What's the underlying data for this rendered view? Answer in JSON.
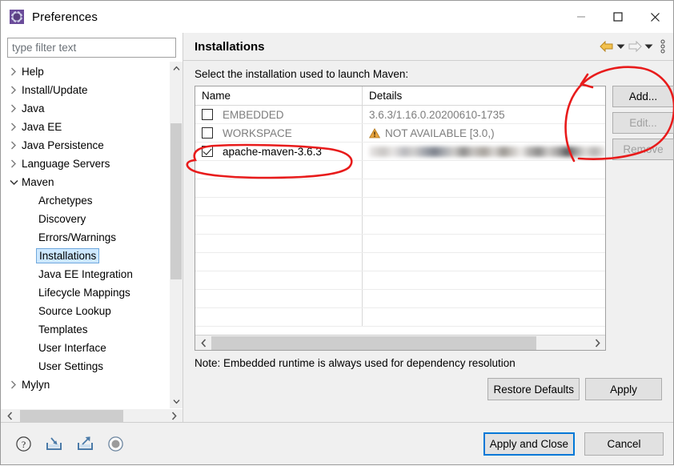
{
  "window": {
    "title": "Preferences",
    "app_icon": "gear-icon",
    "controls": {
      "minimize": "minimize-icon",
      "maximize": "maximize-icon",
      "close": "close-icon"
    }
  },
  "sidebar": {
    "filter": {
      "placeholder": "type filter text",
      "value": ""
    },
    "items": [
      {
        "label": "Help",
        "level": 0,
        "twisty": "collapsed",
        "selected": false
      },
      {
        "label": "Install/Update",
        "level": 0,
        "twisty": "collapsed",
        "selected": false
      },
      {
        "label": "Java",
        "level": 0,
        "twisty": "collapsed",
        "selected": false
      },
      {
        "label": "Java EE",
        "level": 0,
        "twisty": "collapsed",
        "selected": false
      },
      {
        "label": "Java Persistence",
        "level": 0,
        "twisty": "collapsed",
        "selected": false
      },
      {
        "label": "Language Servers",
        "level": 0,
        "twisty": "collapsed",
        "selected": false
      },
      {
        "label": "Maven",
        "level": 0,
        "twisty": "expanded",
        "selected": false
      },
      {
        "label": "Archetypes",
        "level": 1,
        "twisty": "none",
        "selected": false
      },
      {
        "label": "Discovery",
        "level": 1,
        "twisty": "none",
        "selected": false
      },
      {
        "label": "Errors/Warnings",
        "level": 1,
        "twisty": "none",
        "selected": false
      },
      {
        "label": "Installations",
        "level": 1,
        "twisty": "none",
        "selected": true
      },
      {
        "label": "Java EE Integration",
        "level": 1,
        "twisty": "none",
        "selected": false
      },
      {
        "label": "Lifecycle Mappings",
        "level": 1,
        "twisty": "none",
        "selected": false
      },
      {
        "label": "Source Lookup",
        "level": 1,
        "twisty": "none",
        "selected": false
      },
      {
        "label": "Templates",
        "level": 1,
        "twisty": "none",
        "selected": false
      },
      {
        "label": "User Interface",
        "level": 1,
        "twisty": "none",
        "selected": false
      },
      {
        "label": "User Settings",
        "level": 1,
        "twisty": "none",
        "selected": false
      },
      {
        "label": "Mylyn",
        "level": 0,
        "twisty": "collapsed",
        "selected": false
      }
    ]
  },
  "page": {
    "title": "Installations",
    "description": "Select the installation used to launch Maven:",
    "note": "Note: Embedded runtime is always used for dependency resolution",
    "toolbar": [
      {
        "name": "back-arrow-icon",
        "state": "enabled"
      },
      {
        "name": "back-dropdown-icon",
        "state": "enabled"
      },
      {
        "name": "forward-arrow-icon",
        "state": "disabled"
      },
      {
        "name": "forward-dropdown-icon",
        "state": "enabled"
      },
      {
        "name": "view-menu-icon",
        "state": "enabled"
      }
    ]
  },
  "table": {
    "columns": [
      "Name",
      "Details"
    ],
    "rows": [
      {
        "checked": false,
        "name": "EMBEDDED",
        "details": "3.6.3/1.16.0.20200610-1735",
        "dimmed": true,
        "warning": false,
        "redacted": false
      },
      {
        "checked": false,
        "name": "WORKSPACE",
        "details": "NOT AVAILABLE [3.0,)",
        "dimmed": true,
        "warning": true,
        "redacted": false
      },
      {
        "checked": true,
        "name": "apache-maven-3.6.3",
        "details": "",
        "dimmed": false,
        "warning": false,
        "redacted": true
      }
    ],
    "empty_rows": 9
  },
  "buttons": {
    "add": {
      "label": "Add...",
      "enabled": true
    },
    "edit": {
      "label": "Edit...",
      "enabled": false
    },
    "remove": {
      "label": "Remove",
      "enabled": false
    },
    "restore_defaults": {
      "label": "Restore Defaults",
      "enabled": true
    },
    "apply": {
      "label": "Apply",
      "enabled": true
    },
    "apply_and_close": {
      "label": "Apply and Close",
      "enabled": true,
      "default": true
    },
    "cancel": {
      "label": "Cancel",
      "enabled": true
    }
  },
  "footer_icons": [
    {
      "name": "help-icon"
    },
    {
      "name": "import-preferences-icon"
    },
    {
      "name": "export-preferences-icon"
    },
    {
      "name": "toggle-icon"
    }
  ],
  "annotations": {
    "color": "#e81b1b",
    "shapes": [
      "circle-around-add-edit-buttons",
      "arrow-to-add-button",
      "circle-around-apache-maven-row"
    ]
  },
  "colors": {
    "selection": "#cde8ff",
    "selection_border": "#6fa8dc",
    "default_button_border": "#0078d7",
    "warning": "#e8a33d",
    "accent_arrow": "#e8a33d",
    "annotation_red": "#e81b1b"
  }
}
